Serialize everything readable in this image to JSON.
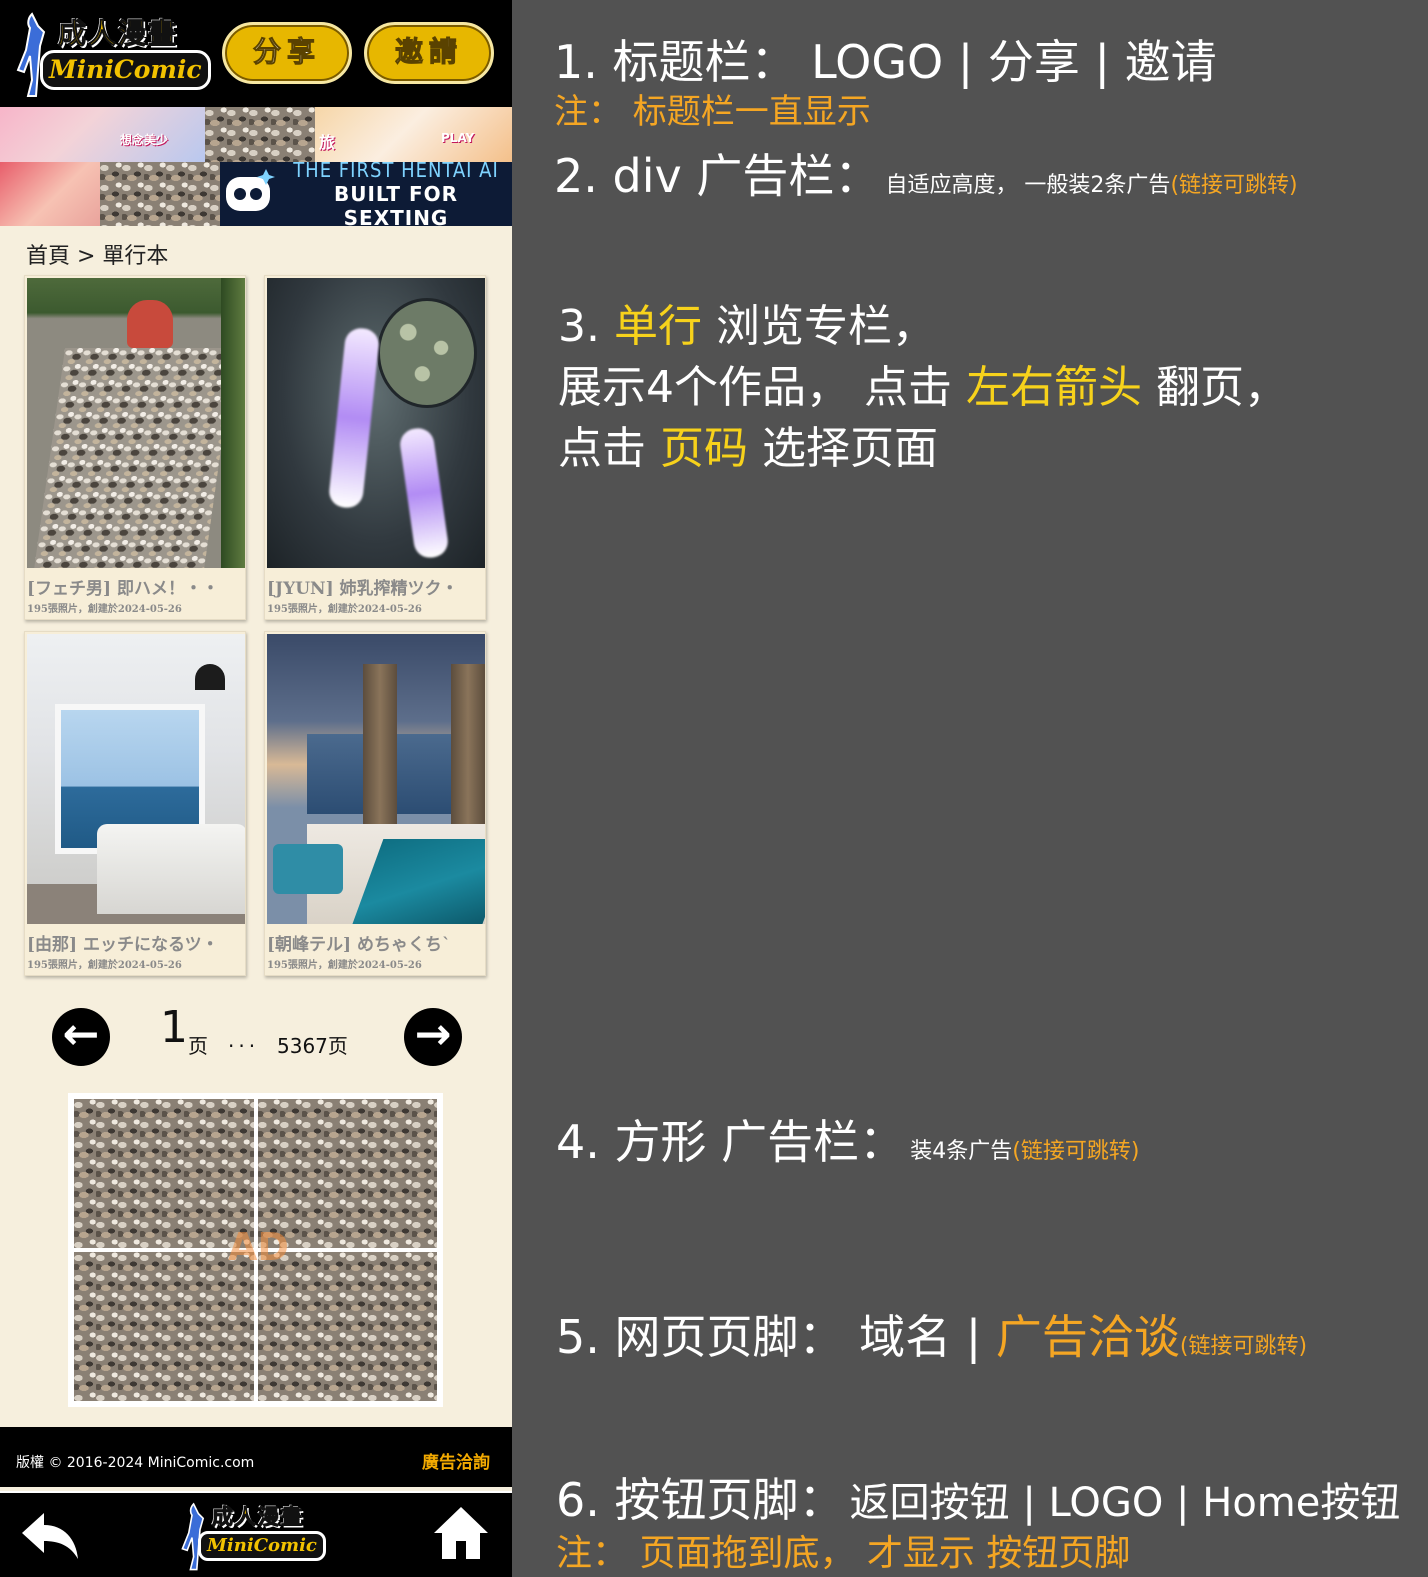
{
  "header": {
    "logo": {
      "zh": "成人漫畫",
      "en": "MiniComic"
    },
    "share_label": "分享",
    "invite_label": "邀請"
  },
  "ads": {
    "banner1_tag": "想念美少",
    "banner1_tag2": "旅",
    "banner1_tag3": "PLAY",
    "banner2_line1": "THE FIRST HENTAI AI",
    "banner2_line2": "BUILT FOR SEXTING"
  },
  "breadcrumb": "首頁 > 單行本",
  "works": [
    {
      "title": "[フェチ男] 即ハメ！・・",
      "meta": "195張照片，創建於2024-05-26"
    },
    {
      "title": "[JYUN] 姉乳搾精ツク・",
      "meta": "195張照片，創建於2024-05-26"
    },
    {
      "title": "[由那] エッチになるツ・",
      "meta": "195張照片，創建於2024-05-26"
    },
    {
      "title": "[朝峰テル] めちゃくち`",
      "meta": "195張照片，創建於2024-05-26"
    }
  ],
  "pager": {
    "current": "1",
    "unit": "页",
    "dots": "...",
    "last": "5367页",
    "prev_icon": "arrow-left-icon",
    "next_icon": "arrow-right-icon"
  },
  "square_ad_mark": "AD",
  "footer": {
    "copyright": "版權 © 2016-2024 MiniComic.com",
    "ad_link": "廣告洽詢"
  },
  "button_footer": {
    "back_icon": "back-arrow-icon",
    "logo": {
      "zh": "成人漫畫",
      "en": "MiniComic"
    },
    "home_icon": "home-icon"
  },
  "notes": {
    "n1_main": "1. 标题栏： LOGO | 分享 | 邀请",
    "n1_sub": "注： 标题栏一直显示",
    "n2_main": "2. div 广告栏：",
    "n2_small": "自适应高度， 一般装2条广告",
    "n2_link": "(链接可跳转)",
    "n3_l1_a": "3. ",
    "n3_l1_b": "单行",
    "n3_l1_c": " 浏览专栏，",
    "n3_l2_a": "展示4个作品， 点击 ",
    "n3_l2_b": "左右箭头",
    "n3_l2_c": " 翻页，",
    "n3_l3_a": "点击 ",
    "n3_l3_b": "页码",
    "n3_l3_c": " 选择页面",
    "n4_main": "4. 方形 广告栏：",
    "n4_small": "装4条广告",
    "n4_link": "(链接可跳转)",
    "n5_main": "5. 网页页脚： 域名 | ",
    "n5_highlight": "广告洽谈",
    "n5_link": "(链接可跳转)",
    "n6_main": "6. 按钮页脚：",
    "n6_small": "返回按钮 | LOGO | Home按钮",
    "n6_sub": "注： 页面拖到底， 才显示 按钮页脚"
  },
  "colors": {
    "accent_yellow": "#f7d21b",
    "accent_orange": "#f5a623",
    "panel_bg": "#525252",
    "phone_bg": "#f6efdd",
    "button_gold": "#e7b700"
  }
}
